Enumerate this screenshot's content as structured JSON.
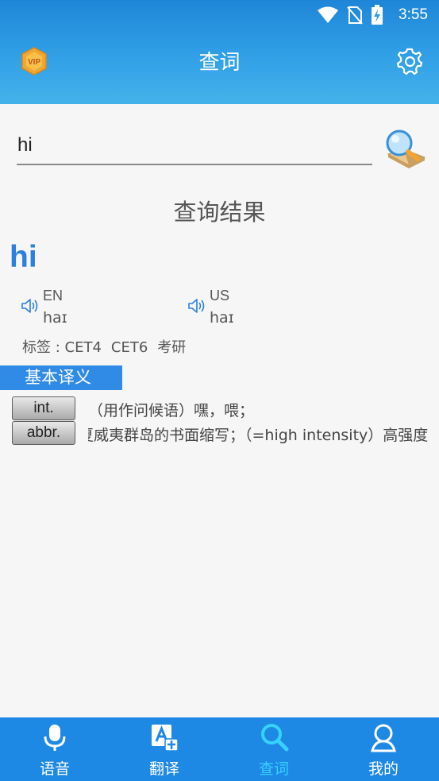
{
  "status_bar": {
    "time": "3:55"
  },
  "toolbar": {
    "title": "查词"
  },
  "search": {
    "value": "hi"
  },
  "result": {
    "heading": "查询结果",
    "word": "hi",
    "phonetics": [
      {
        "label": "EN",
        "ipa": "haɪ"
      },
      {
        "label": "US",
        "ipa": "haɪ"
      }
    ],
    "tags_label": "标签 : ",
    "tags": [
      "CET4",
      "CET6",
      "考研"
    ],
    "basic_tab": "基本译义",
    "definitions": [
      {
        "pos": "int.",
        "text": "（用作问候语）嘿，喂；"
      },
      {
        "pos": "abbr.",
        "text": "夏威夷群岛的书面缩写；（=high intensity）高强度"
      }
    ]
  },
  "nav": {
    "items": [
      {
        "label": "语音",
        "icon": "microphone-icon"
      },
      {
        "label": "翻译",
        "icon": "translate-icon"
      },
      {
        "label": "查词",
        "icon": "search-icon",
        "active": true
      },
      {
        "label": "我的",
        "icon": "user-icon"
      }
    ]
  },
  "colors": {
    "header": "#2f9ee6",
    "accent": "#2b7fdd",
    "nav_bg": "#1e88e5",
    "nav_active": "#36d1ff"
  }
}
